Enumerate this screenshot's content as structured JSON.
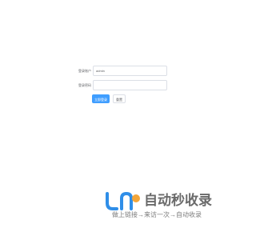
{
  "login": {
    "account_label": "登录账户",
    "account_value": "admin",
    "password_label": "登录密码",
    "password_value": "",
    "login_button": "立即登录",
    "reset_button": "重置"
  },
  "watermark": {
    "title": "自动秒收录",
    "subtitle": "做上链接→来访一次→自动收录",
    "colors": {
      "blue": "#2f8ee8",
      "orange": "#f3a63a",
      "gray": "#6a6a6a"
    }
  }
}
